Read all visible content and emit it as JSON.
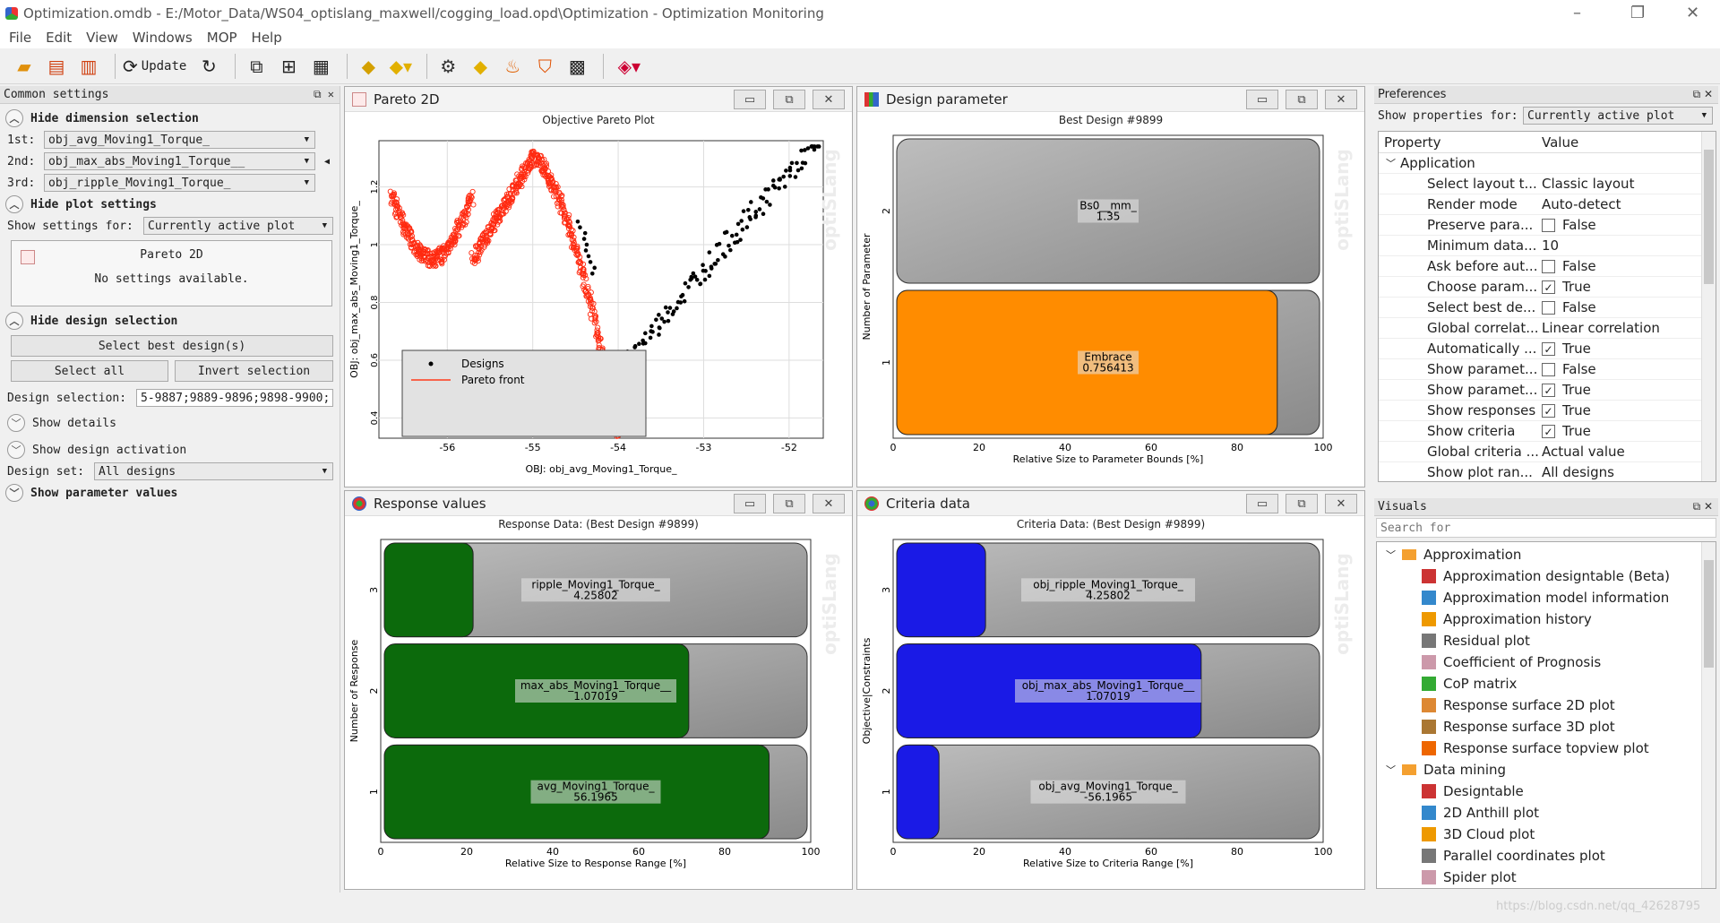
{
  "window": {
    "title": "Optimization.omdb - E:/Motor_Data/WS04_optislang_maxwell/cogging_load.opd\\Optimization - Optimization Monitoring",
    "minimize": "–",
    "maximize": "❐",
    "close": "✕"
  },
  "menu": [
    "File",
    "Edit",
    "View",
    "Windows",
    "MOP",
    "Help"
  ],
  "toolbar": {
    "update_label": "Update"
  },
  "left": {
    "header": "Common settings",
    "hide_dim": "Hide dimension selection",
    "dim": [
      {
        "label": "1st:",
        "value": "obj_avg_Moving1_Torque_"
      },
      {
        "label": "2nd:",
        "value": "obj_max_abs_Moving1_Torque__"
      },
      {
        "label": "3rd:",
        "value": "obj_ripple_Moving1_Torque_"
      }
    ],
    "hide_plot": "Hide plot settings",
    "show_for_label": "Show settings for:",
    "show_for_value": "Currently active plot",
    "box_title": "Pareto 2D",
    "box_text": "No settings available.",
    "hide_design": "Hide design selection",
    "select_best": "Select best design(s)",
    "select_all": "Select all",
    "invert": "Invert selection",
    "design_sel_label": "Design selection:",
    "design_sel_value": "5-9887;9889-9896;9898-9900;",
    "show_details": "Show details",
    "show_activation": "Show design activation",
    "design_set_label": "Design set:",
    "design_set_value": "All designs",
    "show_param": "Show parameter values"
  },
  "pareto": {
    "title": "Pareto 2D",
    "subtitle": "Objective Pareto Plot",
    "xlabel": "OBJ: obj_avg_Moving1_Torque_",
    "ylabel": "OBJ: obj_max_abs_Moving1_Torque_",
    "xticks": [
      "-56",
      "-55",
      "-54",
      "-53",
      "-52"
    ],
    "yticks": [
      "0.4",
      "0.6",
      "0.8",
      "1",
      "1.2"
    ],
    "legend_designs": "Designs",
    "legend_front": "Pareto front"
  },
  "design_param": {
    "title": "Design parameter",
    "subtitle": "Best Design #9899",
    "ylabel": "Number of Parameter",
    "xlabel": "Relative Size to Parameter Bounds [%]",
    "xticks": [
      "0",
      "20",
      "40",
      "60",
      "80",
      "100"
    ],
    "bars": [
      {
        "num": "2",
        "name": "Bs0__mm_",
        "value": "1.35",
        "pct": 0,
        "color": "#9a9a9a"
      },
      {
        "num": "1",
        "name": "Embrace",
        "value": "0.756413",
        "pct": 90,
        "color": "#ff8c00"
      }
    ]
  },
  "response": {
    "title": "Response values",
    "subtitle": "Response Data: (Best Design #9899)",
    "ylabel": "Number of Response",
    "xlabel": "Relative Size to Response Range [%]",
    "xticks": [
      "0",
      "20",
      "40",
      "60",
      "80",
      "100"
    ],
    "bars": [
      {
        "num": "3",
        "name": "ripple_Moving1_Torque_",
        "value": "4.25802",
        "pct": 21,
        "color": "#0c6a0c"
      },
      {
        "num": "2",
        "name": "max_abs_Moving1_Torque__",
        "value": "1.07019",
        "pct": 72,
        "color": "#0c6a0c"
      },
      {
        "num": "1",
        "name": "avg_Moving1_Torque_",
        "value": "56.1965",
        "pct": 91,
        "color": "#0c6a0c"
      }
    ]
  },
  "criteria": {
    "title": "Criteria data",
    "subtitle": "Criteria Data: (Best Design #9899)",
    "ylabel": "Objective|Constraints",
    "xlabel": "Relative Size to Criteria Range [%]",
    "xticks": [
      "0",
      "20",
      "40",
      "60",
      "80",
      "100"
    ],
    "bars": [
      {
        "num": "3",
        "name": "obj_ripple_Moving1_Torque_",
        "value": "4.25802",
        "pct": 21,
        "color": "#1a1ae6"
      },
      {
        "num": "2",
        "name": "obj_max_abs_Moving1_Torque__",
        "value": "1.07019",
        "pct": 72,
        "color": "#1a1ae6"
      },
      {
        "num": "1",
        "name": "obj_avg_Moving1_Torque_",
        "value": "-56.1965",
        "pct": 10,
        "color": "#1a1ae6"
      }
    ]
  },
  "watermark": "optiSLang",
  "prefs": {
    "header": "Preferences",
    "show_for_label": "Show properties for:",
    "show_for_value": "Currently active plot",
    "col_property": "Property",
    "col_value": "Value",
    "group": "Application",
    "rows": [
      {
        "name": "Select layout t...",
        "value": "Classic layout",
        "check": ""
      },
      {
        "name": "Render mode",
        "value": "Auto-detect",
        "check": ""
      },
      {
        "name": "Preserve para...",
        "value": "False",
        "check": "off"
      },
      {
        "name": "Minimum data...",
        "value": "10",
        "check": ""
      },
      {
        "name": "Ask before aut...",
        "value": "False",
        "check": "off"
      },
      {
        "name": "Choose param...",
        "value": "True",
        "check": "on"
      },
      {
        "name": "Select best de...",
        "value": "False",
        "check": "off"
      },
      {
        "name": "Global correlat...",
        "value": "Linear correlation",
        "check": ""
      },
      {
        "name": "Automatically ...",
        "value": "True",
        "check": "on"
      },
      {
        "name": "Show paramet...",
        "value": "False",
        "check": "off"
      },
      {
        "name": "Show paramet...",
        "value": "True",
        "check": "on"
      },
      {
        "name": "Show responses",
        "value": "True",
        "check": "on"
      },
      {
        "name": "Show criteria",
        "value": "True",
        "check": "on"
      },
      {
        "name": "Global criteria ...",
        "value": "Actual value",
        "check": ""
      },
      {
        "name": "Show plot ran...",
        "value": "All designs",
        "check": ""
      }
    ]
  },
  "visuals": {
    "header": "Visuals",
    "search_placeholder": "Search for",
    "groups": [
      {
        "name": "Approximation",
        "items": [
          "Approximation designtable (Beta)",
          "Approximation model information",
          "Approximation history",
          "Residual plot",
          "Coefficient of Prognosis",
          "CoP matrix",
          "Response surface 2D plot",
          "Response surface 3D plot",
          "Response surface topview plot"
        ]
      },
      {
        "name": "Data mining",
        "items": [
          "Designtable",
          "2D Anthill plot",
          "3D Cloud plot",
          "Parallel coordinates plot",
          "Spider plot"
        ]
      }
    ]
  },
  "footer_watermark": "https://blog.csdn.net/qq_42628795"
}
